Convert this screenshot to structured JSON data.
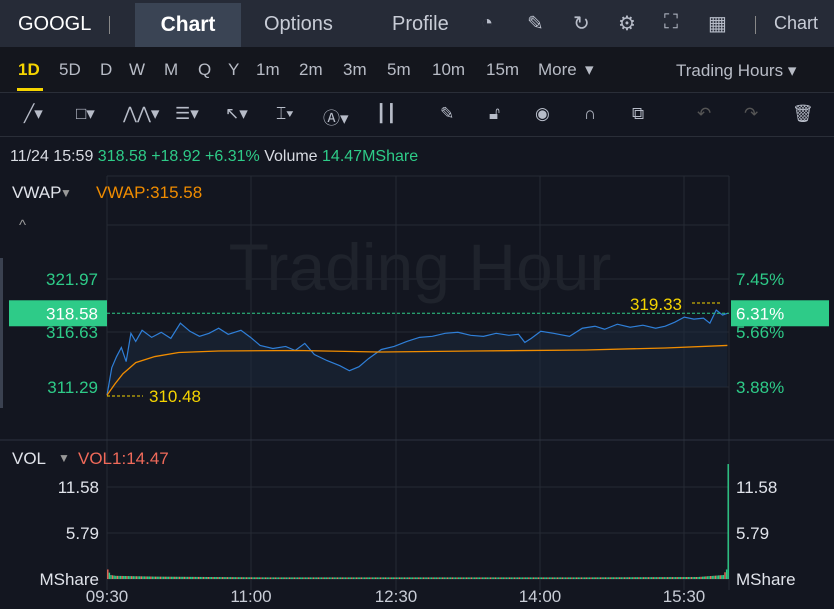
{
  "header": {
    "symbol": "GOOGL",
    "tabs": [
      "Chart",
      "Options",
      "Profile"
    ],
    "right_label": "Chart"
  },
  "periods": [
    "1D",
    "5D",
    "D",
    "W",
    "M",
    "Q",
    "Y",
    "1m",
    "2m",
    "3m",
    "5m",
    "10m",
    "15m",
    "More"
  ],
  "trading_hours": "Trading Hours",
  "info": {
    "datetime": "11/24 15:59",
    "price": "318.58",
    "change": "+18.92",
    "pct": "+6.31%",
    "vol_label": "Volume",
    "vol": "14.47MShare"
  },
  "watermark": "Trading Hour",
  "colors": {
    "up": "#2ecb88",
    "price_line": "#2f7fd8",
    "vwap": "#f08c00",
    "highlight": "#f5d400",
    "vol_ind": "#f06a5a"
  },
  "chart_data": {
    "type": "line",
    "indicator_label": "VWAP",
    "indicator_value": "VWAP:315.58",
    "y_ticks_left": [
      "321.97",
      "316.63",
      "311.29"
    ],
    "y_ticks_right": [
      "7.45%",
      "5.66%",
      "3.88%"
    ],
    "current_price": "318.58",
    "current_pct": "6.31%",
    "high_label": "319.33",
    "low_label": "310.48",
    "x_ticks": [
      "09:30",
      "11:00",
      "12:30",
      "14:00",
      "15:30"
    ],
    "ylim": [
      311.29,
      321.97
    ],
    "price": [
      [
        0,
        310.48
      ],
      [
        3,
        313.2
      ],
      [
        6,
        314.3
      ],
      [
        9,
        315.2
      ],
      [
        12,
        313.8
      ],
      [
        15,
        316.6
      ],
      [
        18,
        315.8
      ],
      [
        22,
        316.9
      ],
      [
        28,
        316.2
      ],
      [
        34,
        316.7
      ],
      [
        40,
        316.1
      ],
      [
        46,
        317.6
      ],
      [
        52,
        316.8
      ],
      [
        58,
        316.3
      ],
      [
        64,
        316.6
      ],
      [
        70,
        317.1
      ],
      [
        76,
        316.5
      ],
      [
        84,
        316.9
      ],
      [
        90,
        316.2
      ],
      [
        96,
        315.4
      ],
      [
        104,
        315.1
      ],
      [
        112,
        315.3
      ],
      [
        118,
        314.9
      ],
      [
        124,
        315.6
      ],
      [
        130,
        314.5
      ],
      [
        138,
        313.9
      ],
      [
        146,
        313.4
      ],
      [
        152,
        312.9
      ],
      [
        158,
        313.3
      ],
      [
        164,
        314.1
      ],
      [
        172,
        315.0
      ],
      [
        180,
        315.3
      ],
      [
        188,
        315.8
      ],
      [
        196,
        316.2
      ],
      [
        204,
        316.3
      ],
      [
        212,
        316.6
      ],
      [
        220,
        316.7
      ],
      [
        228,
        316.4
      ],
      [
        236,
        316.3
      ],
      [
        244,
        316.6
      ],
      [
        252,
        316.4
      ],
      [
        258,
        316.5
      ],
      [
        262,
        315.7
      ],
      [
        266,
        316.1
      ],
      [
        272,
        316.8
      ],
      [
        280,
        316.6
      ],
      [
        290,
        316.3
      ],
      [
        298,
        317.1
      ],
      [
        306,
        317.3
      ],
      [
        312,
        317.0
      ],
      [
        320,
        317.5
      ],
      [
        328,
        317.2
      ],
      [
        336,
        317.4
      ],
      [
        344,
        317.1
      ],
      [
        350,
        317.3
      ],
      [
        356,
        317.7
      ],
      [
        362,
        318.2
      ],
      [
        368,
        318.0
      ],
      [
        374,
        318.1
      ],
      [
        378,
        317.6
      ],
      [
        382,
        318.9
      ],
      [
        386,
        318.4
      ],
      [
        389,
        318.58
      ]
    ],
    "vwap": [
      [
        0,
        310.48
      ],
      [
        5,
        311.6
      ],
      [
        10,
        312.6
      ],
      [
        18,
        313.7
      ],
      [
        30,
        314.3
      ],
      [
        45,
        314.7
      ],
      [
        70,
        314.85
      ],
      [
        120,
        314.9
      ],
      [
        170,
        314.75
      ],
      [
        230,
        314.85
      ],
      [
        300,
        314.95
      ],
      [
        350,
        315.15
      ],
      [
        389,
        315.4
      ]
    ],
    "volume_label": "VOL",
    "volume_value": "VOL1:14.47",
    "vol_ticks": [
      "11.58",
      "5.79",
      "MShare"
    ],
    "vol_max": 17.37,
    "volume": [
      [
        0,
        1.2
      ],
      [
        1,
        0.8
      ],
      [
        2,
        0.5
      ],
      [
        5,
        0.4
      ],
      [
        30,
        0.3
      ],
      [
        100,
        0.2
      ],
      [
        200,
        0.2
      ],
      [
        300,
        0.2
      ],
      [
        370,
        0.25
      ],
      [
        386,
        0.5
      ],
      [
        388,
        1.2
      ],
      [
        389,
        14.47
      ]
    ]
  }
}
